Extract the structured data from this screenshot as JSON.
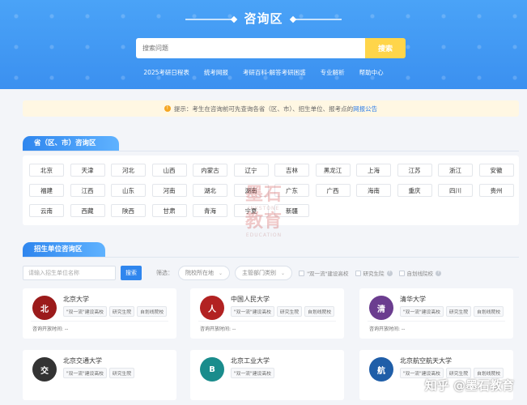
{
  "header": {
    "title": "咨询区",
    "search_placeholder": "搜索问题",
    "search_button": "搜索",
    "nav": [
      "2025考研日程表",
      "统考网报",
      "考研百科-解答考研困惑",
      "专业解析",
      "帮助中心"
    ]
  },
  "notice": {
    "text": "提示：考生在咨询前可先查询各省（区、市）、招生单位、报考点的",
    "link": "网报公告"
  },
  "province_section": {
    "title": "省（区、市）咨询区",
    "provinces": [
      "北京",
      "天津",
      "河北",
      "山西",
      "内蒙古",
      "辽宁",
      "吉林",
      "黑龙江",
      "上海",
      "江苏",
      "浙江",
      "安徽",
      "福建",
      "江西",
      "山东",
      "河南",
      "湖北",
      "湖南",
      "广东",
      "广西",
      "海南",
      "重庆",
      "四川",
      "贵州",
      "云南",
      "西藏",
      "陕西",
      "甘肃",
      "青海",
      "宁夏",
      "新疆"
    ]
  },
  "unit_section": {
    "title": "招生单位咨询区",
    "input_placeholder": "请输入招生单位名称",
    "search_button": "搜索",
    "filter_label": "筛选：",
    "select_location": "院校所在地",
    "select_department": "主管部门类别",
    "check_double_first": "\"双一流\"建设高校",
    "check_graduate": "研究生院",
    "check_self_line": "自划线院校"
  },
  "universities": [
    {
      "name": "北京大学",
      "tags": [
        "\"双一流\"建设高校",
        "研究生院",
        "自划线院校"
      ],
      "open": "咨询开放时间: --",
      "logo_color": "#9b1b1b",
      "logo_text": "北"
    },
    {
      "name": "中国人民大学",
      "tags": [
        "\"双一流\"建设高校",
        "研究生院",
        "自划线院校"
      ],
      "open": "咨询开放时间: --",
      "logo_color": "#b22222",
      "logo_text": "人"
    },
    {
      "name": "清华大学",
      "tags": [
        "\"双一流\"建设高校",
        "研究生院",
        "自划线院校"
      ],
      "open": "咨询开放时间: --",
      "logo_color": "#6b3d8f",
      "logo_text": "清"
    },
    {
      "name": "北京交通大学",
      "tags": [
        "\"双一流\"建设高校",
        "研究生院"
      ],
      "open": "",
      "logo_color": "#333333",
      "logo_text": "交"
    },
    {
      "name": "北京工业大学",
      "tags": [
        "\"双一流\"建设高校"
      ],
      "open": "",
      "logo_color": "#1a8c8c",
      "logo_text": "B"
    },
    {
      "name": "北京航空航天大学",
      "tags": [
        "\"双一流\"建设高校",
        "研究生院",
        "自划线院校"
      ],
      "open": "",
      "logo_color": "#1f5ea8",
      "logo_text": "航"
    }
  ],
  "watermark": {
    "big1": "墨石",
    "big2": "教育",
    "en1": "INKSTONE",
    "en2": "EDUCATION",
    "corner": "知乎 @墨石教育"
  },
  "colors": {
    "primary": "#2f86ee",
    "search_yellow": "#ffd54a",
    "notice_bg": "#fff7e3"
  }
}
